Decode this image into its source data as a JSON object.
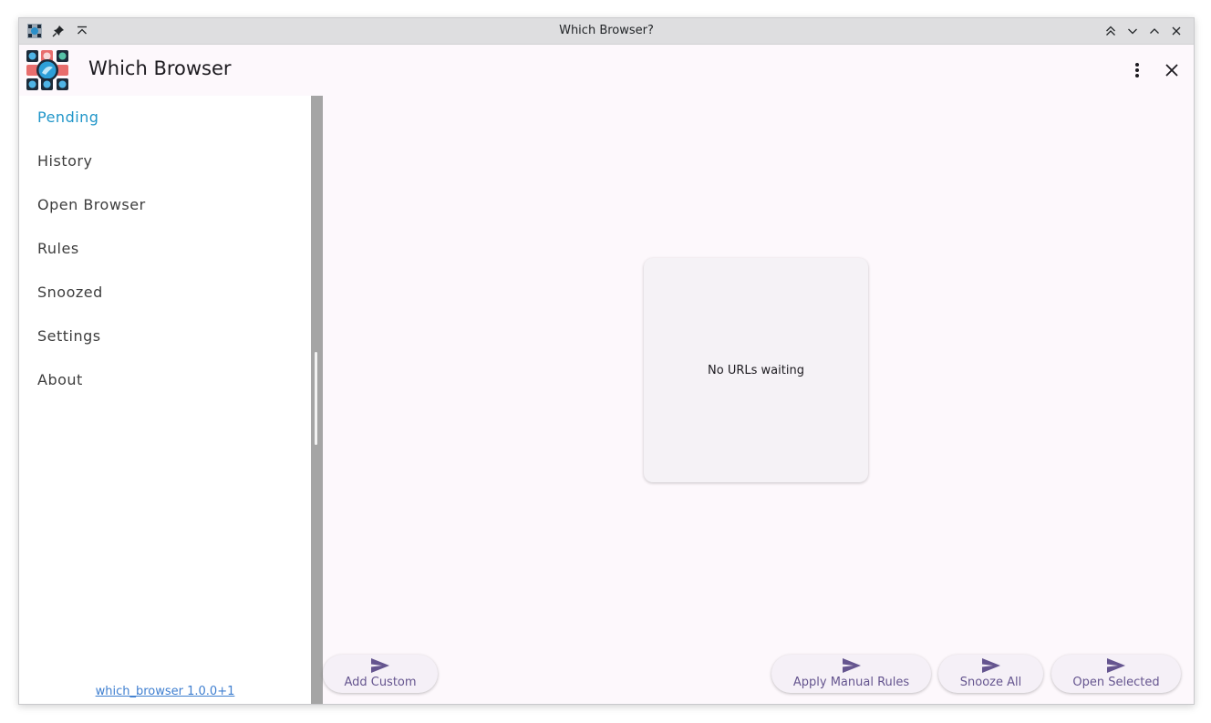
{
  "window": {
    "title": "Which Browser?"
  },
  "appbar": {
    "title": "Which Browser"
  },
  "sidebar": {
    "items": [
      {
        "label": "Pending",
        "active": true
      },
      {
        "label": "History",
        "active": false
      },
      {
        "label": "Open Browser",
        "active": false
      },
      {
        "label": "Rules",
        "active": false
      },
      {
        "label": "Snoozed",
        "active": false
      },
      {
        "label": "Settings",
        "active": false
      },
      {
        "label": "About",
        "active": false
      }
    ],
    "version": "which_browser 1.0.0+1"
  },
  "main": {
    "empty_message": "No URLs waiting"
  },
  "actions": {
    "add_custom": "Add Custom",
    "apply_manual_rules": "Apply Manual Rules",
    "snooze_all": "Snooze All",
    "open_selected": "Open Selected"
  },
  "colors": {
    "active_nav": "#2196c9",
    "action_text": "#65558f",
    "link": "#3f7fd0"
  }
}
